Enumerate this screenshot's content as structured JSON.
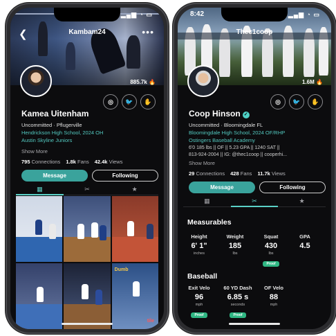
{
  "left": {
    "handle": "Kambam24",
    "overlay_stat": "885.7k",
    "name": "Kamea Uitenham",
    "subtitle": "Uncommitted · Pflugerville",
    "school": "Hendrickson High School, 2024 OH",
    "club": "Austin Skyline Juniors",
    "show_more": "Show More",
    "counts": [
      {
        "value": "795",
        "label": "Connections"
      },
      {
        "value": "1.8k",
        "label": "Fans"
      },
      {
        "value": "42.4k",
        "label": "Views"
      }
    ],
    "message_label": "Message",
    "following_label": "Following",
    "tabs": [
      "grid-icon",
      "stats-icon",
      "star-icon"
    ],
    "grid_labels": {
      "dumb": "Dumb",
      "tile": "tile"
    }
  },
  "right": {
    "time": "8:42",
    "handle": "Thec1coop",
    "overlay_stat": "1.6M",
    "name": "Coop Hinson",
    "subtitle": "Uncommitted · Bloomingdale FL",
    "school": "Bloomingdale High School, 2024 OF/RHP",
    "club": "Ostingers Baseball Academy",
    "bio1": "6'0 185 lbs || OF || 5.23 GPA || 1240 SAT ||",
    "bio2": "813-924-2004 || IG: @thec1coop || cooperhi...",
    "show_more": "Show More",
    "counts": [
      {
        "value": "29",
        "label": "Connections"
      },
      {
        "value": "428",
        "label": "Fans"
      },
      {
        "value": "11.7k",
        "label": "Views"
      }
    ],
    "message_label": "Message",
    "following_label": "Following",
    "measurables_title": "Measurables",
    "measurables": [
      {
        "label": "Height",
        "value": "6' 1\"",
        "unit": "inches",
        "proof": ""
      },
      {
        "label": "Weight",
        "value": "185",
        "unit": "lbs",
        "proof": ""
      },
      {
        "label": "Squat",
        "value": "430",
        "unit": "lbs",
        "proof": "Proof"
      },
      {
        "label": "GPA",
        "value": "4.5",
        "unit": "",
        "proof": ""
      }
    ],
    "baseball_title": "Baseball",
    "baseball": [
      {
        "label": "Exit Velo",
        "value": "96",
        "unit": "mph",
        "proof": "Proof"
      },
      {
        "label": "60 YD Dash",
        "value": "6.85 s",
        "unit": "seconds",
        "proof": "Proof"
      },
      {
        "label": "OF Velo",
        "value": "88",
        "unit": "mph",
        "proof": ""
      }
    ]
  },
  "colors": {
    "accent": "#3aa39c",
    "background": "#0c0c0e",
    "proof": "#2fb783"
  }
}
